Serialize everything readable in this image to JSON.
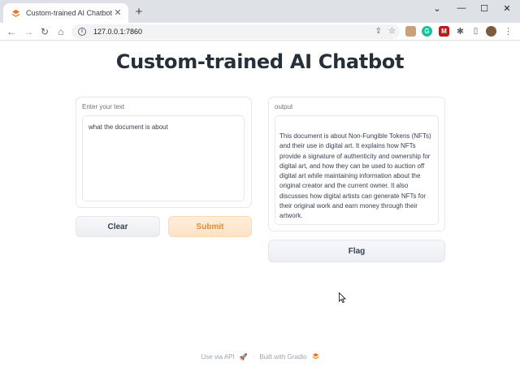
{
  "browser": {
    "tab_title": "Custom-trained AI Chatbot",
    "url": "127.0.0.1:7860",
    "window_controls": [
      "minimize-icon",
      "maximize-icon",
      "close-icon"
    ],
    "nav_icons": [
      "back-icon",
      "forward-icon",
      "reload-icon",
      "home-icon"
    ]
  },
  "app": {
    "title": "Custom-trained AI Chatbot",
    "input": {
      "label": "Enter your text",
      "value": "what the document is about"
    },
    "output": {
      "label": "output",
      "value": "This document is about Non-Fungible Tokens (NFTs) and their use in digital art. It explains how NFTs provide a signature of authenticity and ownership for digital art, and how they can be used to auction off digital art while maintaining information about the original creator and the current owner. It also discusses how digital artists can generate NFTs for their original work and earn money through their artwork."
    },
    "buttons": {
      "clear": "Clear",
      "submit": "Submit",
      "flag": "Flag"
    },
    "footer": {
      "api": "Use via API",
      "separator": "·",
      "built": "Built with Gradio"
    }
  },
  "colors": {
    "accent": "#ea8a2e",
    "submit_bg": "#fde2c6",
    "title": "#25303b"
  }
}
